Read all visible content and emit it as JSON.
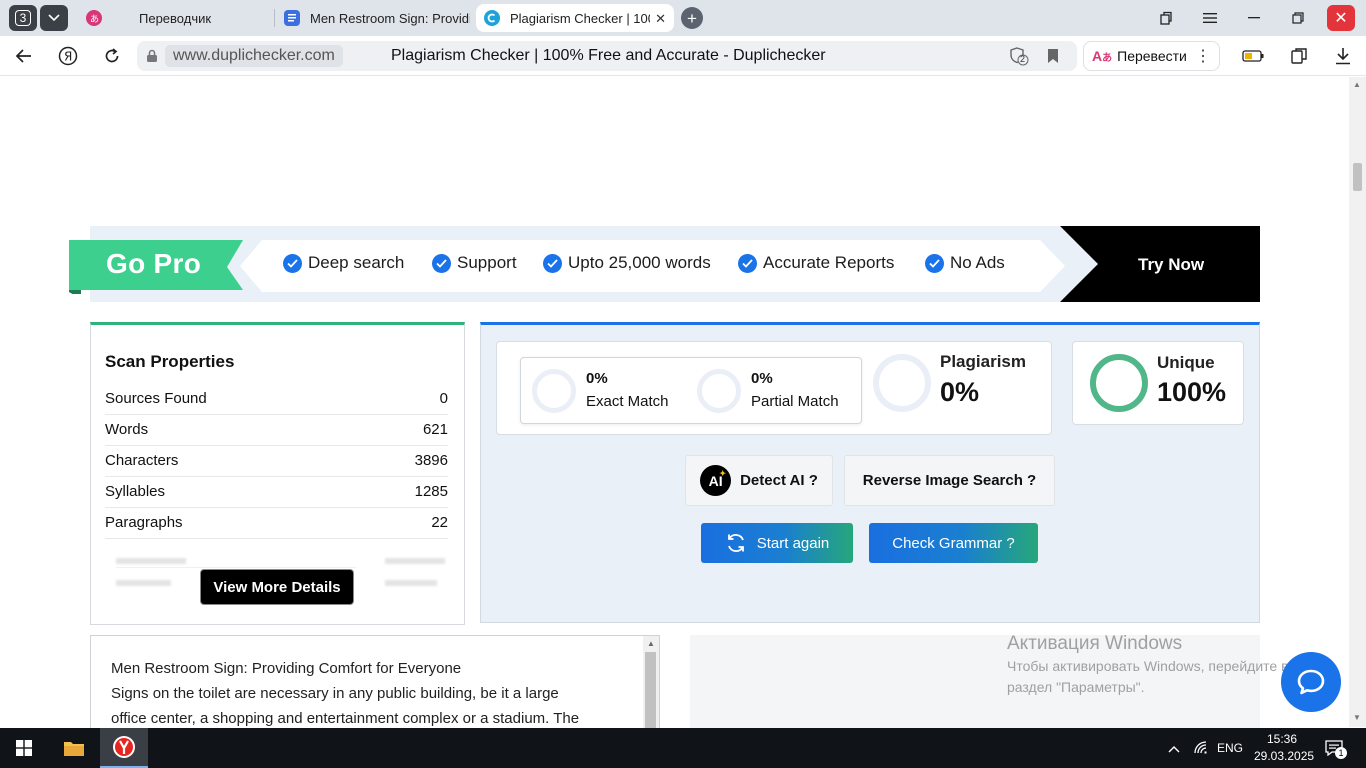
{
  "browser": {
    "tab_count": "3",
    "tabs": [
      {
        "title": "Переводчик"
      },
      {
        "title": "Men Restroom Sign: Providing"
      },
      {
        "title": "Plagiarism Checker | 100% Free"
      }
    ],
    "url": "www.duplichecker.com",
    "page_title": "Plagiarism Checker | 100% Free and Accurate - Duplichecker",
    "translate_label": "Перевести",
    "shield_badge": "2"
  },
  "promo": {
    "gopro": "Go Pro",
    "features": [
      "Deep search",
      "Support",
      "Upto 25,000 words",
      "Accurate Reports",
      "No Ads"
    ],
    "try_now": "Try Now"
  },
  "scan": {
    "title": "Scan Properties",
    "rows": [
      {
        "label": "Sources Found",
        "value": "0"
      },
      {
        "label": "Words",
        "value": "621"
      },
      {
        "label": "Characters",
        "value": "3896"
      },
      {
        "label": "Syllables",
        "value": "1285"
      },
      {
        "label": "Paragraphs",
        "value": "22"
      }
    ],
    "view_more": "View More Details"
  },
  "results": {
    "exact_pct": "0%",
    "exact_label": "Exact Match",
    "partial_pct": "0%",
    "partial_label": "Partial Match",
    "plagiarism_label": "Plagiarism",
    "plagiarism_value": "0%",
    "unique_label": "Unique",
    "unique_value": "100%",
    "unique_fraction": 1.0,
    "detect_ai": "Detect AI ?",
    "reverse_image": "Reverse Image Search ?",
    "start_again": "Start again",
    "check_grammar": "Check Grammar ?"
  },
  "text": {
    "lines": [
      "Men Restroom Sign: Providing Comfort for Everyone",
      "Signs on the toilet are necessary in any public building, be it a large",
      "office center, a shopping and entertainment complex or a stadium. The"
    ]
  },
  "activation": {
    "title": "Активация Windows",
    "line1": "Чтобы активировать Windows, перейдите в",
    "line2": "раздел \"Параметры\"."
  },
  "taskbar": {
    "lang": "ENG",
    "time": "15:36",
    "date": "29.03.2025",
    "notif_count": "1"
  },
  "colors": {
    "accent_blue": "#1a73e8",
    "gopro_green": "#3dcf8e",
    "unique_ring": "#52b788"
  }
}
